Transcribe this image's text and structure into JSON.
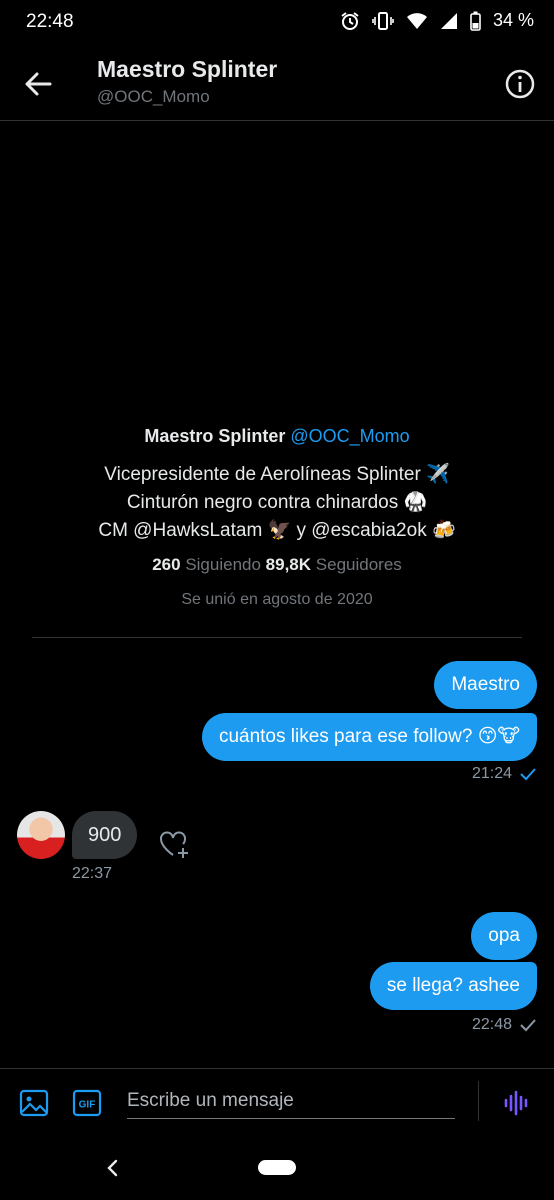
{
  "status": {
    "time": "22:48",
    "battery": "34 %"
  },
  "header": {
    "name": "Maestro Splinter",
    "handle": "@OOC_Momo"
  },
  "profile": {
    "name": "Maestro Splinter",
    "handle": "@OOC_Momo",
    "bio": [
      "Vicepresidente de Aerolíneas Splinter ✈️",
      "Cinturón negro contra chinardos 🥋",
      "CM @HawksLatam 🦅 y @escabia2ok 🍻"
    ],
    "following_count": "260",
    "following_label": "Siguiendo",
    "followers_count": "89,8K",
    "followers_label": "Seguidores",
    "joined": "Se unió en agosto de 2020"
  },
  "messages": {
    "out1": "Maestro",
    "out2": "cuántos likes para ese follow? 😙🐮",
    "time1": "21:24",
    "in1": "900",
    "time2": "22:37",
    "out3": "opa",
    "out4": "se llega? ashee",
    "time3": "22:48"
  },
  "composer": {
    "placeholder": "Escribe un mensaje",
    "gif_label": "GIF"
  },
  "colors": {
    "accent": "#1d9bf0",
    "background": "#000000",
    "incoming_bubble": "#2f3336",
    "voice": "#7856ff"
  }
}
